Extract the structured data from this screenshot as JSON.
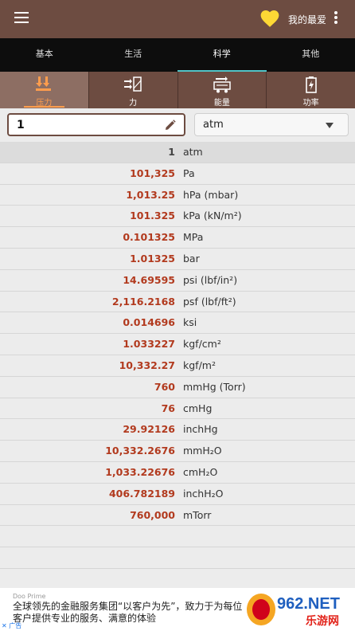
{
  "header": {
    "favorites_label": "我的最爱",
    "accent": "#6d4c41",
    "heart_color": "#fdd835"
  },
  "tabs": [
    {
      "label": "基本",
      "active": false
    },
    {
      "label": "生活",
      "active": false
    },
    {
      "label": "科学",
      "active": true
    },
    {
      "label": "其他",
      "active": false
    }
  ],
  "subtabs": [
    {
      "label": "压力",
      "icon": "pressure-icon",
      "active": true
    },
    {
      "label": "力",
      "icon": "force-icon",
      "active": false
    },
    {
      "label": "能量",
      "icon": "energy-icon",
      "active": false
    },
    {
      "label": "功率",
      "icon": "power-icon",
      "active": false
    }
  ],
  "input": {
    "value": "1",
    "unit": "atm"
  },
  "results": [
    {
      "value": "1",
      "unit": "atm"
    },
    {
      "value": "101,325",
      "unit": "Pa"
    },
    {
      "value": "1,013.25",
      "unit": "hPa (mbar)"
    },
    {
      "value": "101.325",
      "unit": "kPa (kN/m²)"
    },
    {
      "value": "0.101325",
      "unit": "MPa"
    },
    {
      "value": "1.01325",
      "unit": "bar"
    },
    {
      "value": "14.69595",
      "unit": "psi (lbf/in²)"
    },
    {
      "value": "2,116.2168",
      "unit": "psf (lbf/ft²)"
    },
    {
      "value": "0.014696",
      "unit": "ksi"
    },
    {
      "value": "1.033227",
      "unit": "kgf/cm²"
    },
    {
      "value": "10,332.27",
      "unit": "kgf/m²"
    },
    {
      "value": "760",
      "unit": "mmHg (Torr)"
    },
    {
      "value": "76",
      "unit": "cmHg"
    },
    {
      "value": "29.92126",
      "unit": "inchHg"
    },
    {
      "value": "10,332.2676",
      "unit": "mmH₂O"
    },
    {
      "value": "1,033.22676",
      "unit": "cmH₂O"
    },
    {
      "value": "406.782189",
      "unit": "inchH₂O"
    },
    {
      "value": "760,000",
      "unit": "mTorr"
    }
  ],
  "ad": {
    "brand": "Doo Prime",
    "text": "全球领先的金融服务集团“以客户为先”，致力于为每位客户提供专业的服务、满意的体验",
    "flag": "✕ 广告",
    "logo_text": "962.NET",
    "logo_sub": "乐游网"
  }
}
